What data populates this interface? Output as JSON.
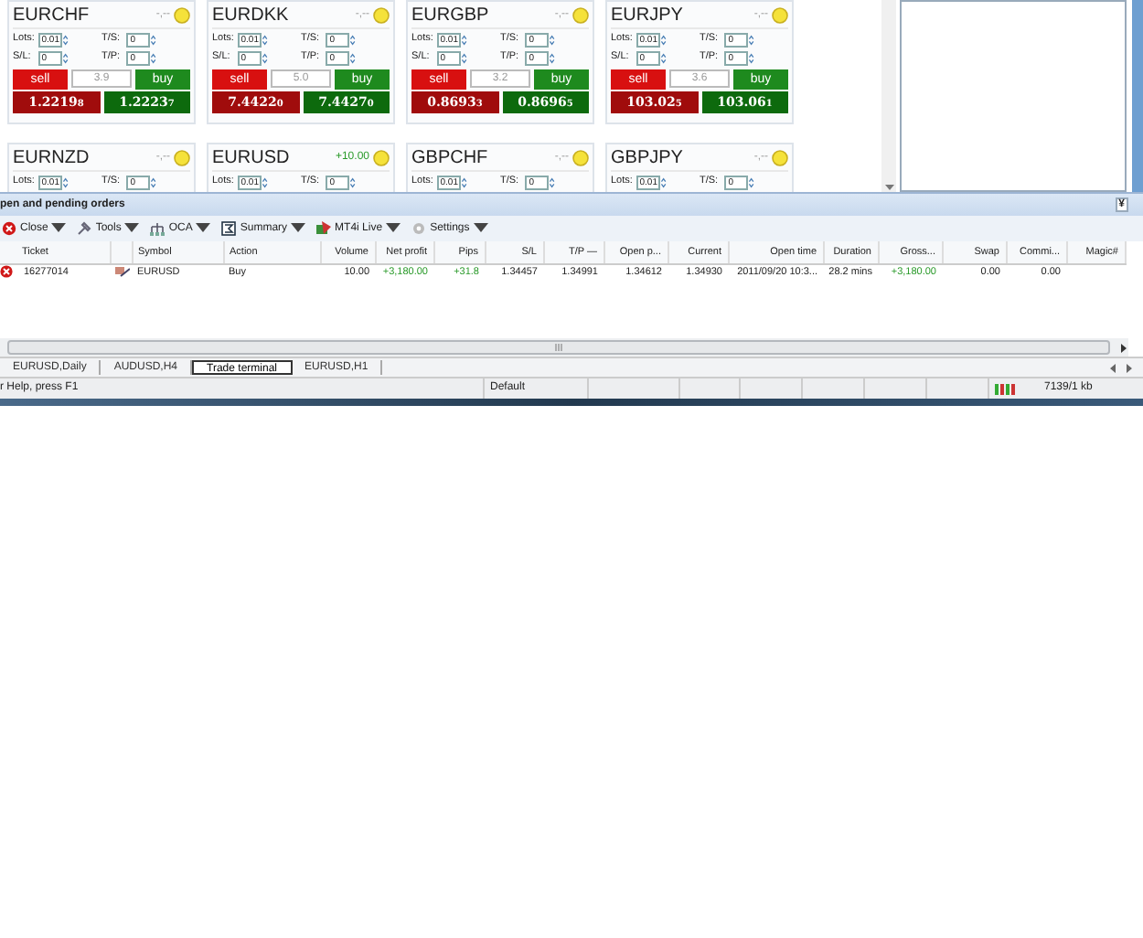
{
  "tiles": [
    {
      "symbol": "EURCHF",
      "profit": {
        "text": "-,--"
      },
      "fields": [
        {
          "label": "Lots:",
          "value": "0.01"
        },
        {
          "label": "T/S:",
          "value": "0"
        },
        {
          "label": "S/L:",
          "value": "0"
        },
        {
          "label": "T/P:",
          "value": "0"
        }
      ],
      "trade": {
        "sell_label": "sell",
        "spread": "3.9",
        "buy_label": "buy",
        "sell": "1.2219$_{8}$",
        "buy": "1.2223$_{7}$"
      }
    },
    {
      "symbol": "EURDKK",
      "profit": {
        "text": "-,--"
      },
      "fields": [
        {
          "label": "Lots:",
          "value": "0.01"
        },
        {
          "label": "T/S:",
          "value": "0"
        },
        {
          "label": "S/L:",
          "value": "0"
        },
        {
          "label": "T/P:",
          "value": "0"
        }
      ],
      "trade": {
        "sell_label": "sell",
        "spread": "5.0",
        "buy_label": "buy",
        "sell": "7.4422$_{0}$",
        "buy": "7.4427$_{0}$"
      }
    },
    {
      "symbol": "EURGBP",
      "profit": {
        "text": "-,--"
      },
      "fields": [
        {
          "label": "Lots:",
          "value": "0.01"
        },
        {
          "label": "T/S:",
          "value": "0"
        },
        {
          "label": "S/L:",
          "value": "0"
        },
        {
          "label": "T/P:",
          "value": "0"
        }
      ],
      "trade": {
        "sell_label": "sell",
        "spread": "3.2",
        "buy_label": "buy",
        "sell": "0.8693$_{3}$",
        "buy": "0.8696$_{5}$"
      }
    },
    {
      "symbol": "EURJPY",
      "profit": {
        "text": "-,--"
      },
      "fields": [
        {
          "label": "Lots:",
          "value": "0.01"
        },
        {
          "label": "T/S:",
          "value": "0"
        },
        {
          "label": "S/L:",
          "value": "0"
        },
        {
          "label": "T/P:",
          "value": "0"
        }
      ],
      "trade": {
        "sell_label": "sell",
        "spread": "3.6",
        "buy_label": "buy",
        "sell": "103.02$_{5}$",
        "buy": "103.06$_{1}$"
      }
    },
    {
      "symbol": "EURNZD",
      "profit": {
        "text": "-,--"
      },
      "fields": [
        {
          "label": "Lots:",
          "value": "0.01"
        },
        {
          "label": "T/S:",
          "value": "0"
        }
      ]
    },
    {
      "symbol": "EURUSD",
      "profit": {
        "text": "+10.00",
        "color": "#2a9a2a"
      },
      "fields": [
        {
          "label": "Lots:",
          "value": "0.01"
        },
        {
          "label": "T/S:",
          "value": "0"
        }
      ]
    },
    {
      "symbol": "GBPCHF",
      "profit": {
        "text": "-,--"
      },
      "fields": [
        {
          "label": "Lots:",
          "value": "0.01"
        },
        {
          "label": "T/S:",
          "value": "0"
        }
      ]
    },
    {
      "symbol": "GBPJPY",
      "profit": {
        "text": "-,--"
      },
      "fields": [
        {
          "label": "Lots:",
          "value": "0.01"
        },
        {
          "label": "T/S:",
          "value": "0"
        }
      ]
    }
  ],
  "panel": {
    "title": "pen and pending orders",
    "collapse": "¥"
  },
  "toolbar": [
    {
      "label": "Close",
      "kind": "close"
    },
    {
      "label": "Tools",
      "kind": "tools"
    },
    {
      "label": "OCA",
      "kind": "oca"
    },
    {
      "label": "Summary",
      "kind": "summary"
    },
    {
      "label": "MT4i Live",
      "kind": "live"
    },
    {
      "label": "Settings",
      "kind": "settings"
    }
  ],
  "columns": [
    {
      "label": "Ticket"
    },
    {},
    {
      "label": "Symbol"
    },
    {
      "label": "Action"
    },
    {
      "label": "Volume"
    },
    {
      "label": "Net profit"
    },
    {
      "label": "Pips"
    },
    {
      "label": "S/L"
    },
    {
      "label": "T/P —"
    },
    {
      "label": "Open p..."
    },
    {
      "label": "Current"
    },
    {
      "label": "Open time"
    },
    {
      "label": "Duration"
    },
    {
      "label": "Gross..."
    },
    {
      "label": "Swap"
    },
    {
      "label": "Commi..."
    },
    {
      "label": "Magic#"
    }
  ],
  "rows": [
    {
      "cells": [
        {
          "text": "16277014"
        },
        {},
        {
          "text": "EURUSD"
        },
        {
          "text": "Buy"
        },
        {
          "text": "10.00"
        },
        {
          "text": "+3,180.00",
          "color": "#2a9a2a"
        },
        {
          "text": "+31.8",
          "color": "#2a9a2a"
        },
        {
          "text": "1.34457"
        },
        {
          "text": "1.34991"
        },
        {
          "text": "1.34612"
        },
        {
          "text": "1.34930"
        },
        {
          "text": "2011/09/20 10:3..."
        },
        {
          "text": "28.2 mins"
        },
        {
          "text": "+3,180.00",
          "color": "#2a9a2a"
        },
        {
          "text": "0.00"
        },
        {
          "text": "0.00"
        },
        {}
      ]
    }
  ],
  "tabs": [
    {
      "label": "EURUSD,Daily",
      "selected": false
    },
    {
      "label": "AUDUSD,H4",
      "selected": false
    },
    {
      "label": "Trade terminal",
      "selected": true
    },
    {
      "label": "EURUSD,H1",
      "selected": false
    }
  ],
  "status": {
    "help": "r Help, press F1",
    "profile": "Default",
    "traffic": "7139/1 kb"
  }
}
